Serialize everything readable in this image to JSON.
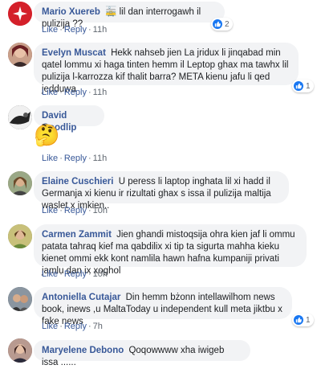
{
  "comments": [
    {
      "name": "Mario Xuereb",
      "text": "lil dan interrogawh il pulizija ??",
      "emoji": "🚋",
      "like": "Like",
      "reply": "Reply",
      "time": "11h",
      "reactions": "2",
      "avatar_color": "#d4202a"
    },
    {
      "name": "Evelyn Muscat",
      "text": "Hekk nahseb jien La jridux li jinqabad min qatel lommu xi haga tinten hemm il Leptop ghax ma tawhx lil pulizija l-karrozza kif thalit barra? META kienu jafu li qed jedduwa",
      "like": "Like",
      "reply": "Reply",
      "time": "11h",
      "reactions": "1",
      "avatar_color": "#7a3b3b"
    },
    {
      "name": "David Goodlip",
      "emoji": "🤔",
      "like": "Like",
      "reply": "Reply",
      "time": "11h",
      "avatar_color": "#2b2b2b"
    },
    {
      "name": "Elaine Cuschieri",
      "text": "U peress li laptop inghata lil xi hadd il Germanja xi kienu ir rizultati ghax s issa il pulizija maltija waslet x imkien..",
      "like": "Like",
      "reply": "Reply",
      "time": "10h",
      "avatar_color": "#8a7a5a"
    },
    {
      "name": "Carmen Zammit",
      "text": "Jien ghandi mistoqsija ohra kien jaf li ommu patata tahraq kief ma qabdilix xi tip ta sigurta mahha kieku kienet ommi ekk kont namlila hawn hafna kumpaniji privati jamlu dan ix xoghol",
      "like": "Like",
      "reply": "Reply",
      "time": "10h",
      "avatar_color": "#6b7a3a"
    },
    {
      "name": "Antoniella Cutajar",
      "text": "Din hemm bżonn intellawilhom news book, inews ,u MaltaToday u independent kull meta jiktbu x fake news",
      "like": "Like",
      "reply": "Reply",
      "time": "7h",
      "reactions": "1",
      "avatar_color": "#4a5a6a"
    },
    {
      "name": "Maryelene Debono",
      "text": "Qoqowwww xha iwigeb issa ......",
      "avatar_color": "#7a5a5a"
    }
  ]
}
